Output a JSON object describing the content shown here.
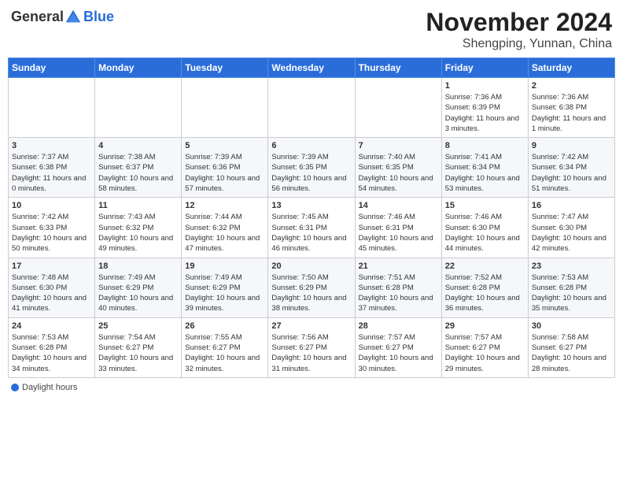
{
  "header": {
    "logo_general": "General",
    "logo_blue": "Blue",
    "title": "November 2024",
    "subtitle": "Shengping, Yunnan, China"
  },
  "weekdays": [
    "Sunday",
    "Monday",
    "Tuesday",
    "Wednesday",
    "Thursday",
    "Friday",
    "Saturday"
  ],
  "weeks": [
    [
      {
        "day": "",
        "info": ""
      },
      {
        "day": "",
        "info": ""
      },
      {
        "day": "",
        "info": ""
      },
      {
        "day": "",
        "info": ""
      },
      {
        "day": "",
        "info": ""
      },
      {
        "day": "1",
        "info": "Sunrise: 7:36 AM\nSunset: 6:39 PM\nDaylight: 11 hours and 3 minutes."
      },
      {
        "day": "2",
        "info": "Sunrise: 7:36 AM\nSunset: 6:38 PM\nDaylight: 11 hours and 1 minute."
      }
    ],
    [
      {
        "day": "3",
        "info": "Sunrise: 7:37 AM\nSunset: 6:38 PM\nDaylight: 11 hours and 0 minutes."
      },
      {
        "day": "4",
        "info": "Sunrise: 7:38 AM\nSunset: 6:37 PM\nDaylight: 10 hours and 58 minutes."
      },
      {
        "day": "5",
        "info": "Sunrise: 7:39 AM\nSunset: 6:36 PM\nDaylight: 10 hours and 57 minutes."
      },
      {
        "day": "6",
        "info": "Sunrise: 7:39 AM\nSunset: 6:35 PM\nDaylight: 10 hours and 56 minutes."
      },
      {
        "day": "7",
        "info": "Sunrise: 7:40 AM\nSunset: 6:35 PM\nDaylight: 10 hours and 54 minutes."
      },
      {
        "day": "8",
        "info": "Sunrise: 7:41 AM\nSunset: 6:34 PM\nDaylight: 10 hours and 53 minutes."
      },
      {
        "day": "9",
        "info": "Sunrise: 7:42 AM\nSunset: 6:34 PM\nDaylight: 10 hours and 51 minutes."
      }
    ],
    [
      {
        "day": "10",
        "info": "Sunrise: 7:42 AM\nSunset: 6:33 PM\nDaylight: 10 hours and 50 minutes."
      },
      {
        "day": "11",
        "info": "Sunrise: 7:43 AM\nSunset: 6:32 PM\nDaylight: 10 hours and 49 minutes."
      },
      {
        "day": "12",
        "info": "Sunrise: 7:44 AM\nSunset: 6:32 PM\nDaylight: 10 hours and 47 minutes."
      },
      {
        "day": "13",
        "info": "Sunrise: 7:45 AM\nSunset: 6:31 PM\nDaylight: 10 hours and 46 minutes."
      },
      {
        "day": "14",
        "info": "Sunrise: 7:46 AM\nSunset: 6:31 PM\nDaylight: 10 hours and 45 minutes."
      },
      {
        "day": "15",
        "info": "Sunrise: 7:46 AM\nSunset: 6:30 PM\nDaylight: 10 hours and 44 minutes."
      },
      {
        "day": "16",
        "info": "Sunrise: 7:47 AM\nSunset: 6:30 PM\nDaylight: 10 hours and 42 minutes."
      }
    ],
    [
      {
        "day": "17",
        "info": "Sunrise: 7:48 AM\nSunset: 6:30 PM\nDaylight: 10 hours and 41 minutes."
      },
      {
        "day": "18",
        "info": "Sunrise: 7:49 AM\nSunset: 6:29 PM\nDaylight: 10 hours and 40 minutes."
      },
      {
        "day": "19",
        "info": "Sunrise: 7:49 AM\nSunset: 6:29 PM\nDaylight: 10 hours and 39 minutes."
      },
      {
        "day": "20",
        "info": "Sunrise: 7:50 AM\nSunset: 6:29 PM\nDaylight: 10 hours and 38 minutes."
      },
      {
        "day": "21",
        "info": "Sunrise: 7:51 AM\nSunset: 6:28 PM\nDaylight: 10 hours and 37 minutes."
      },
      {
        "day": "22",
        "info": "Sunrise: 7:52 AM\nSunset: 6:28 PM\nDaylight: 10 hours and 36 minutes."
      },
      {
        "day": "23",
        "info": "Sunrise: 7:53 AM\nSunset: 6:28 PM\nDaylight: 10 hours and 35 minutes."
      }
    ],
    [
      {
        "day": "24",
        "info": "Sunrise: 7:53 AM\nSunset: 6:28 PM\nDaylight: 10 hours and 34 minutes."
      },
      {
        "day": "25",
        "info": "Sunrise: 7:54 AM\nSunset: 6:27 PM\nDaylight: 10 hours and 33 minutes."
      },
      {
        "day": "26",
        "info": "Sunrise: 7:55 AM\nSunset: 6:27 PM\nDaylight: 10 hours and 32 minutes."
      },
      {
        "day": "27",
        "info": "Sunrise: 7:56 AM\nSunset: 6:27 PM\nDaylight: 10 hours and 31 minutes."
      },
      {
        "day": "28",
        "info": "Sunrise: 7:57 AM\nSunset: 6:27 PM\nDaylight: 10 hours and 30 minutes."
      },
      {
        "day": "29",
        "info": "Sunrise: 7:57 AM\nSunset: 6:27 PM\nDaylight: 10 hours and 29 minutes."
      },
      {
        "day": "30",
        "info": "Sunrise: 7:58 AM\nSunset: 6:27 PM\nDaylight: 10 hours and 28 minutes."
      }
    ]
  ],
  "legend": {
    "daylight_label": "Daylight hours"
  }
}
